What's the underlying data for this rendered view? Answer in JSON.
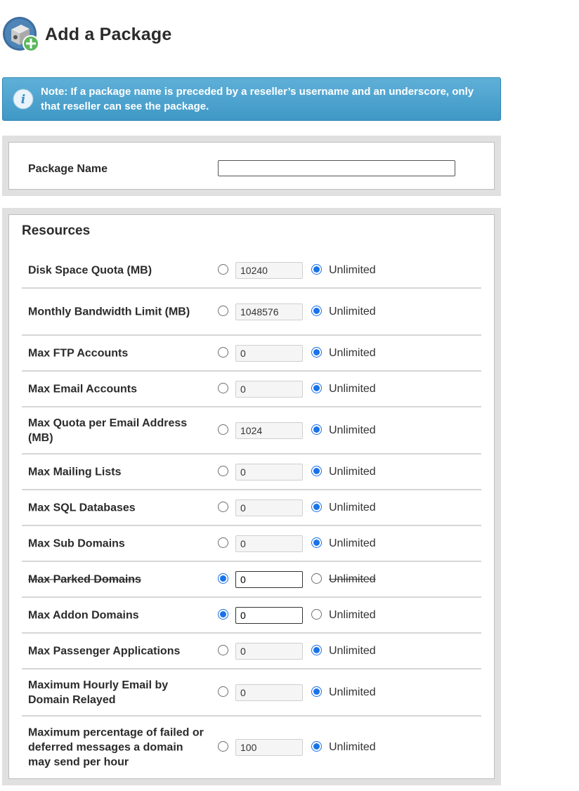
{
  "page": {
    "title": "Add a Package"
  },
  "note": {
    "text": "Note: If a package name is preceded by a reseller’s username and an underscore, only that reseller can see the package."
  },
  "package_name": {
    "label": "Package Name",
    "value": ""
  },
  "resources": {
    "title": "Resources",
    "unlimited_label": "Unlimited",
    "rows": [
      {
        "label": "Disk Space Quota (MB)",
        "value": "10240",
        "unlimited": true
      },
      {
        "label": "Monthly Bandwidth Limit (MB)",
        "value": "1048576",
        "unlimited": true
      },
      {
        "label": "Max FTP Accounts",
        "value": "0",
        "unlimited": true
      },
      {
        "label": "Max Email Accounts",
        "value": "0",
        "unlimited": true
      },
      {
        "label": "Max Quota per Email Address (MB)",
        "value": "1024",
        "unlimited": true
      },
      {
        "label": "Max Mailing Lists",
        "value": "0",
        "unlimited": true
      },
      {
        "label": "Max SQL Databases",
        "value": "0",
        "unlimited": true
      },
      {
        "label": "Max Sub Domains",
        "value": "0",
        "unlimited": true
      },
      {
        "label": "Max Parked Domains",
        "value": "0",
        "unlimited": false
      },
      {
        "label": "Max Addon Domains",
        "value": "0",
        "unlimited": false
      },
      {
        "label": "Max Passenger Applications",
        "value": "0",
        "unlimited": true
      },
      {
        "label": "Maximum Hourly Email by Domain Relayed",
        "value": "0",
        "unlimited": true
      },
      {
        "label": "Maximum percentage of failed or deferred messages a domain may send per hour",
        "value": "100",
        "unlimited": true
      }
    ]
  },
  "colors": {
    "note_bg": "#4aa3d0",
    "radio_checked": "#1a73e8"
  },
  "icons": {
    "package": "package-add-icon",
    "info": "info-icon"
  }
}
